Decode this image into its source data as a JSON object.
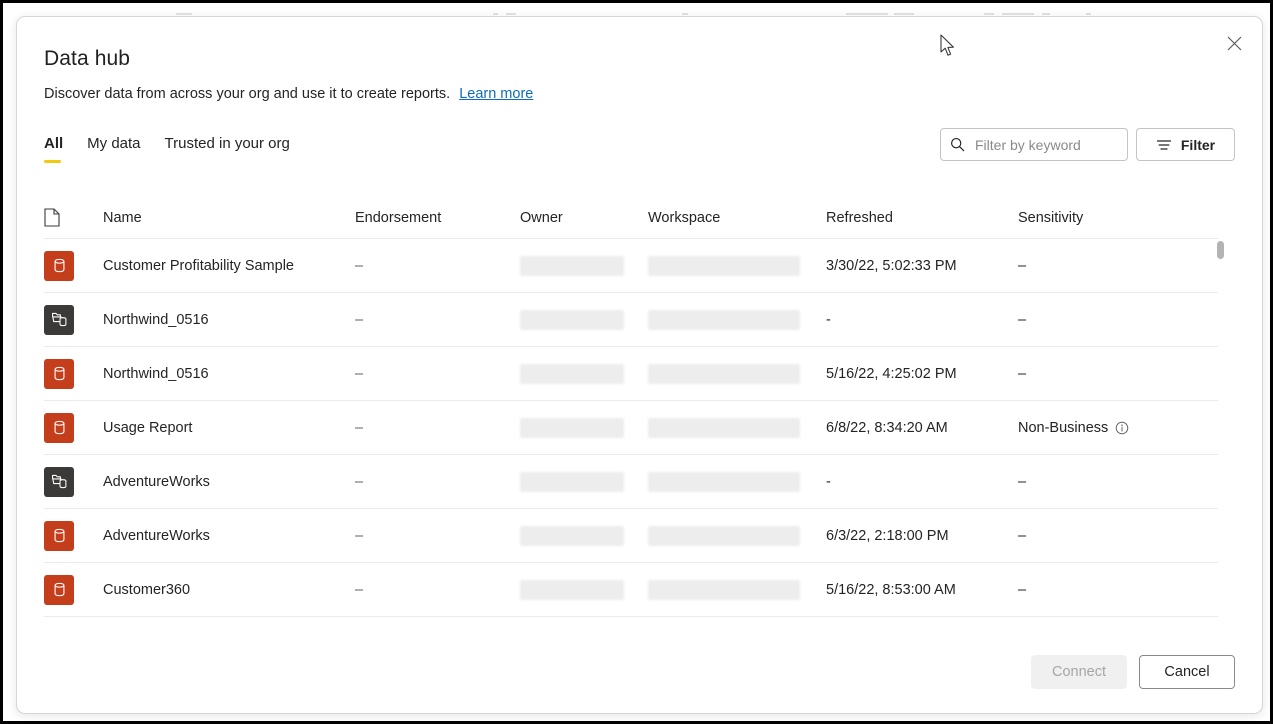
{
  "dialog": {
    "title": "Data hub",
    "subtitle": "Discover data from across your org and use it to create reports.",
    "learn_more": "Learn more",
    "close_label": "Close"
  },
  "tabs": [
    {
      "label": "All",
      "active": true
    },
    {
      "label": "My data",
      "active": false
    },
    {
      "label": "Trusted in your org",
      "active": false
    }
  ],
  "search": {
    "placeholder": "Filter by keyword",
    "value": "",
    "icon": "search-icon"
  },
  "filter_button": {
    "label": "Filter",
    "icon": "filter-icon"
  },
  "table": {
    "columns": [
      {
        "key": "icon",
        "label": "",
        "icon": "document-icon"
      },
      {
        "key": "name",
        "label": "Name"
      },
      {
        "key": "endorsement",
        "label": "Endorsement"
      },
      {
        "key": "owner",
        "label": "Owner"
      },
      {
        "key": "workspace",
        "label": "Workspace"
      },
      {
        "key": "refreshed",
        "label": "Refreshed"
      },
      {
        "key": "sensitivity",
        "label": "Sensitivity"
      }
    ],
    "rows": [
      {
        "icon": "dataset-icon",
        "icon_kind": "dataset",
        "name": "Customer Profitability Sample",
        "endorsement": "–",
        "owner": "",
        "workspace": "",
        "refreshed": "3/30/22, 5:02:33 PM",
        "sensitivity": "–",
        "sensitivity_info": false
      },
      {
        "icon": "datamart-icon",
        "icon_kind": "datamart",
        "name": "Northwind_0516",
        "endorsement": "–",
        "owner": "",
        "workspace": "",
        "refreshed": "-",
        "sensitivity": "–",
        "sensitivity_info": false
      },
      {
        "icon": "dataset-icon",
        "icon_kind": "dataset",
        "name": "Northwind_0516",
        "endorsement": "–",
        "owner": "",
        "workspace": "",
        "refreshed": "5/16/22, 4:25:02 PM",
        "sensitivity": "–",
        "sensitivity_info": false
      },
      {
        "icon": "dataset-icon",
        "icon_kind": "dataset",
        "name": "Usage Report",
        "endorsement": "–",
        "owner": "",
        "workspace": "",
        "refreshed": "6/8/22, 8:34:20 AM",
        "sensitivity": "Non-Business",
        "sensitivity_info": true
      },
      {
        "icon": "datamart-icon",
        "icon_kind": "datamart",
        "name": "AdventureWorks",
        "endorsement": "–",
        "owner": "",
        "workspace": "",
        "refreshed": "-",
        "sensitivity": "–",
        "sensitivity_info": false
      },
      {
        "icon": "dataset-icon",
        "icon_kind": "dataset",
        "name": "AdventureWorks",
        "endorsement": "–",
        "owner": "",
        "workspace": "",
        "refreshed": "6/3/22, 2:18:00 PM",
        "sensitivity": "–",
        "sensitivity_info": false
      },
      {
        "icon": "dataset-icon",
        "icon_kind": "dataset",
        "name": "Customer360",
        "endorsement": "–",
        "owner": "",
        "workspace": "",
        "refreshed": "5/16/22, 8:53:00 AM",
        "sensitivity": "–",
        "sensitivity_info": false
      }
    ]
  },
  "footer": {
    "connect_label": "Connect",
    "connect_disabled": true,
    "cancel_label": "Cancel"
  },
  "colors": {
    "accent_tab_underline": "#f2c811",
    "dataset_icon_bg": "#c43e1c",
    "datamart_icon_bg": "#3b3a39",
    "link": "#0f6cbd",
    "text": "#242424"
  }
}
